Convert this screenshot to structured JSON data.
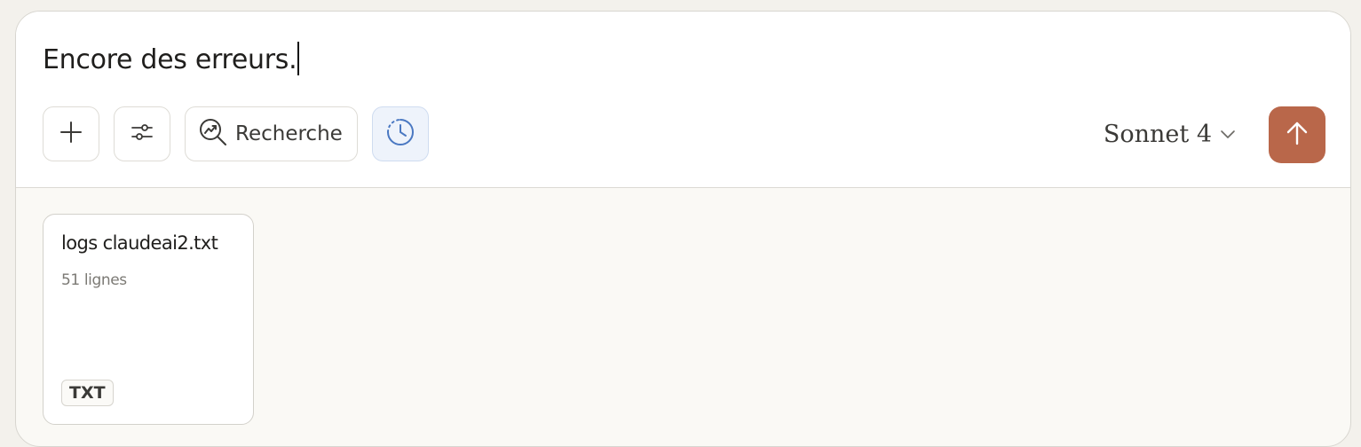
{
  "composer": {
    "prompt_text": "Encore des erreurs."
  },
  "toolbar": {
    "add_icon": "plus-icon",
    "settings_icon": "sliders-icon",
    "research_icon": "research-search-icon",
    "research_label": "Recherche",
    "history_icon": "clock-icon"
  },
  "model": {
    "label": "Sonnet 4",
    "icon": "chevron-down-icon"
  },
  "send": {
    "icon": "arrow-up-icon"
  },
  "attachment": {
    "file_name": "logs claudeai2.txt",
    "line_count": "51 lignes",
    "type_badge": "TXT"
  },
  "colors": {
    "send_button": "#b9674a",
    "history_active_bg": "#eef3fb",
    "history_icon": "#4a78c2"
  }
}
